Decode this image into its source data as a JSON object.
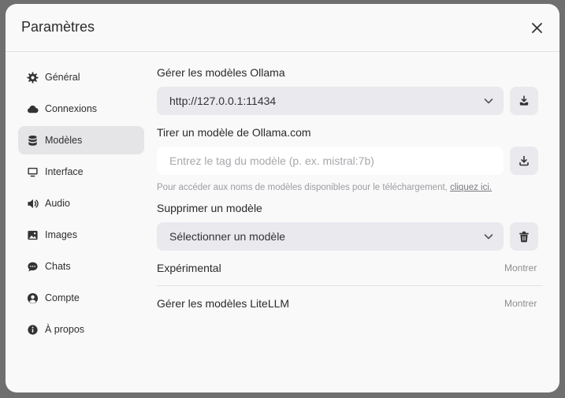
{
  "dialog": {
    "title": "Paramètres"
  },
  "sidebar": {
    "items": [
      {
        "label": "Général",
        "icon": "gear-icon"
      },
      {
        "label": "Connexions",
        "icon": "cloud-icon"
      },
      {
        "label": "Modèles",
        "icon": "database-icon",
        "active": true
      },
      {
        "label": "Interface",
        "icon": "monitor-icon"
      },
      {
        "label": "Audio",
        "icon": "speaker-icon"
      },
      {
        "label": "Images",
        "icon": "image-icon"
      },
      {
        "label": "Chats",
        "icon": "chat-bubble-icon"
      },
      {
        "label": "Compte",
        "icon": "user-circle-icon"
      },
      {
        "label": "À propos",
        "icon": "info-icon"
      }
    ]
  },
  "models": {
    "manage_ollama_label": "Gérer les modèles Ollama",
    "ollama_url_value": "http://127.0.0.1:11434",
    "pull_label": "Tirer un modèle de Ollama.com",
    "pull_placeholder": "Entrez le tag du modèle (p. ex. mistral:7b)",
    "hint_text": "Pour accéder aux noms de modèles disponibles pour le téléchargement,",
    "hint_link": "cliquez ici.",
    "delete_label": "Supprimer un modèle",
    "delete_select_value": "Sélectionner un modèle",
    "experimental_label": "Expérimental",
    "experimental_toggle": "Montrer",
    "litellm_label": "Gérer les modèles LiteLLM",
    "litellm_toggle": "Montrer"
  }
}
